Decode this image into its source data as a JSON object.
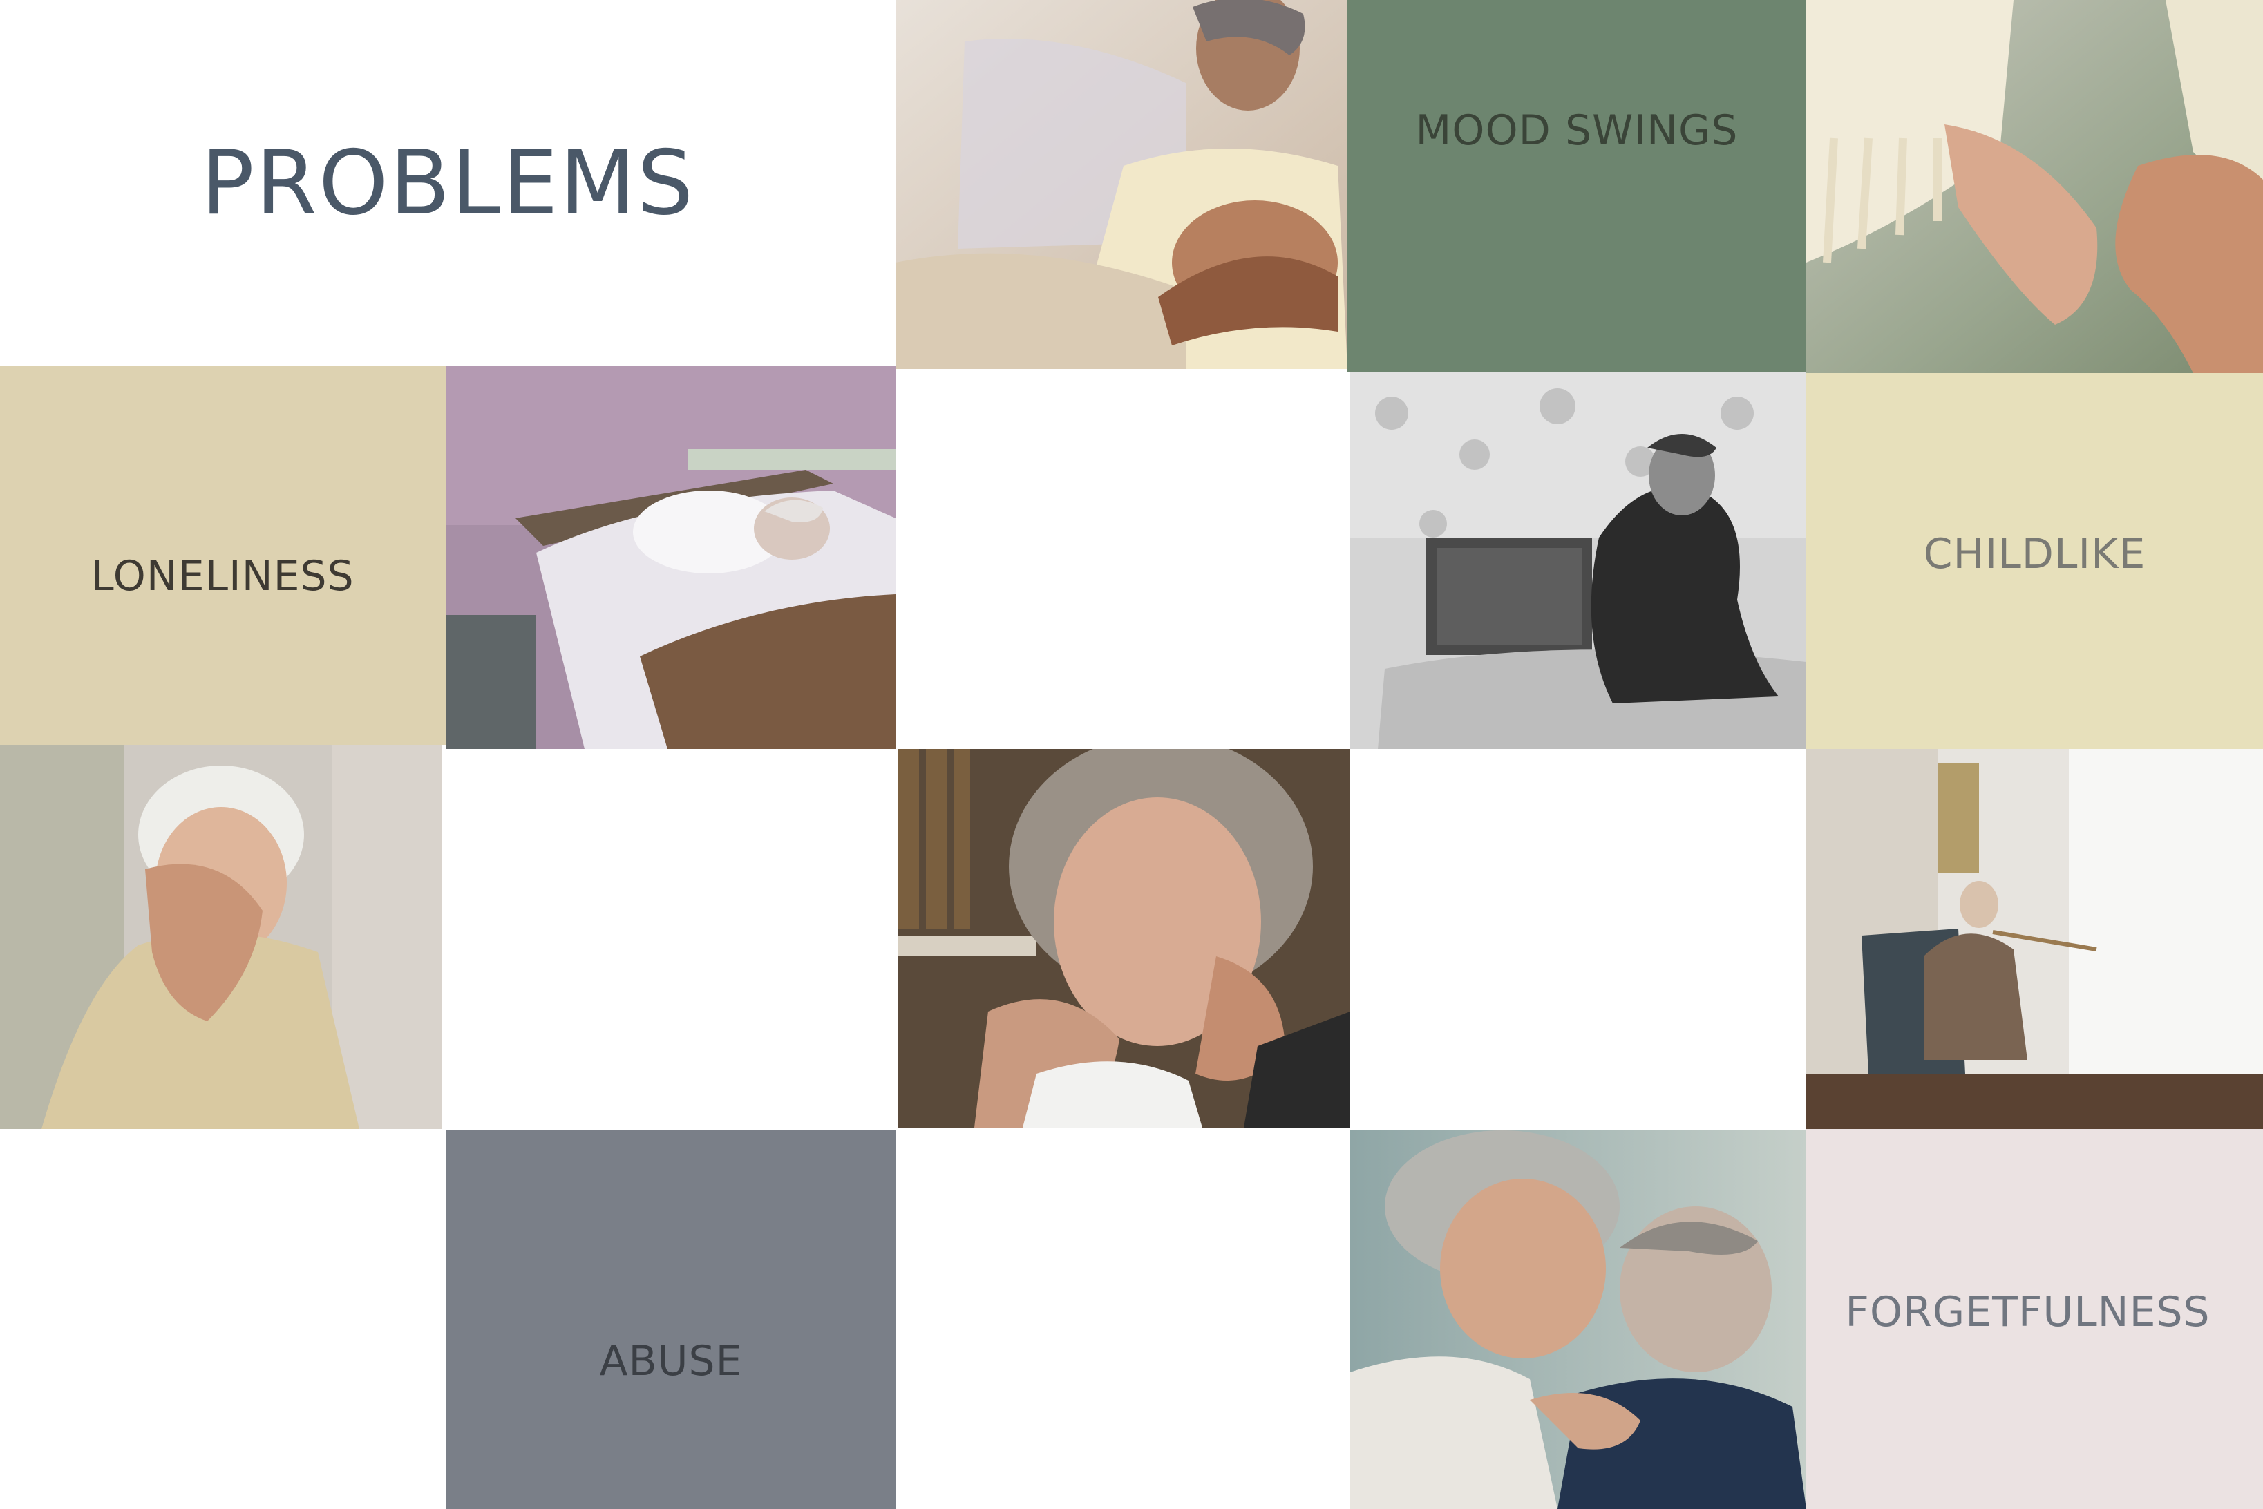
{
  "title": "PROBLEMS",
  "tiles": {
    "mood_swings": "MOOD SWINGS",
    "loneliness": "LONELINESS",
    "childlike": "CHILDLIKE",
    "abuse": "ABUSE",
    "forgetfulness": "FORGETFULNESS"
  },
  "photos": [
    "elderly woman resting in bed with clasped hands",
    "elderly couple holding hands",
    "elderly woman asleep in hospital bed",
    "elderly woman sitting on bed, black and white",
    "elderly woman covering face with hand",
    "elderly woman resting chin on hands",
    "elderly man sitting by window with cane",
    "two elderly people close together"
  ],
  "colors": {
    "title_text": "#4a5868",
    "mood_swings_bg": "#6d856f",
    "loneliness_bg": "#ddd2b1",
    "childlike_bg": "#e7e0bb",
    "abuse_bg": "#7a7f88",
    "forgetfulness_bg": "#ebe2e2"
  }
}
